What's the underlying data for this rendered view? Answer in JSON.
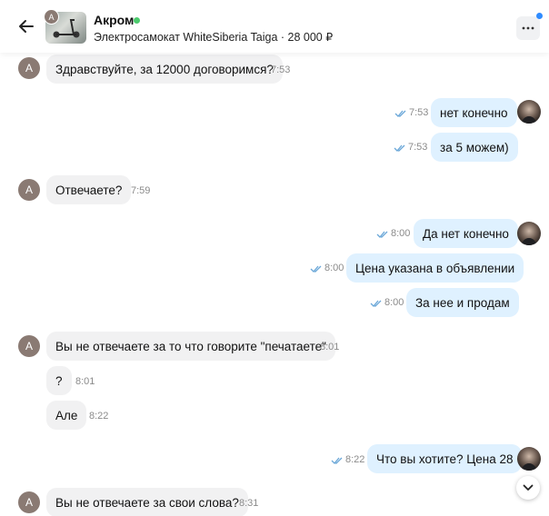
{
  "header": {
    "contact_name": "Акром",
    "avatar_letter": "A",
    "listing_title": "Электросамокат WhiteSiberia Taiga · 28 000 ₽"
  },
  "messages": [
    {
      "direction": "in",
      "text": "Здравствуйте, за 12000 договоримся?",
      "time": "7:53"
    },
    {
      "direction": "out",
      "text": "нет конечно",
      "time": "7:53"
    },
    {
      "direction": "out",
      "text": "за 5 можем)",
      "time": "7:53"
    },
    {
      "direction": "in",
      "text": "Отвечаете?",
      "time": "7:59"
    },
    {
      "direction": "out",
      "text": "Да нет конечно",
      "time": "8:00"
    },
    {
      "direction": "out",
      "text": "Цена указана в объявлении",
      "time": "8:00"
    },
    {
      "direction": "out",
      "text": "За нее и продам",
      "time": "8:00"
    },
    {
      "direction": "in",
      "text": "Вы не отвечаете за то что говорите \"печатаете\"",
      "time": "8:01"
    },
    {
      "direction": "in",
      "text": "?",
      "time": "8:01"
    },
    {
      "direction": "in",
      "text": "Але",
      "time": "8:22"
    },
    {
      "direction": "out",
      "text": "Что вы хотите? Цена 28",
      "time": "8:22"
    },
    {
      "direction": "in",
      "text": "Вы не отвечаете за свои слова?",
      "time": "8:31"
    }
  ],
  "avatars": {
    "in_letter": "A"
  },
  "colors": {
    "incoming_bubble": "#f1f1f2",
    "outgoing_bubble": "#dff1ff",
    "online": "#4ccb6e",
    "check_marks": "#6aa7d8"
  },
  "icons": {
    "back": "arrow-left-icon",
    "menu": "more-horizontal-icon",
    "scroll": "chevron-down-icon"
  }
}
